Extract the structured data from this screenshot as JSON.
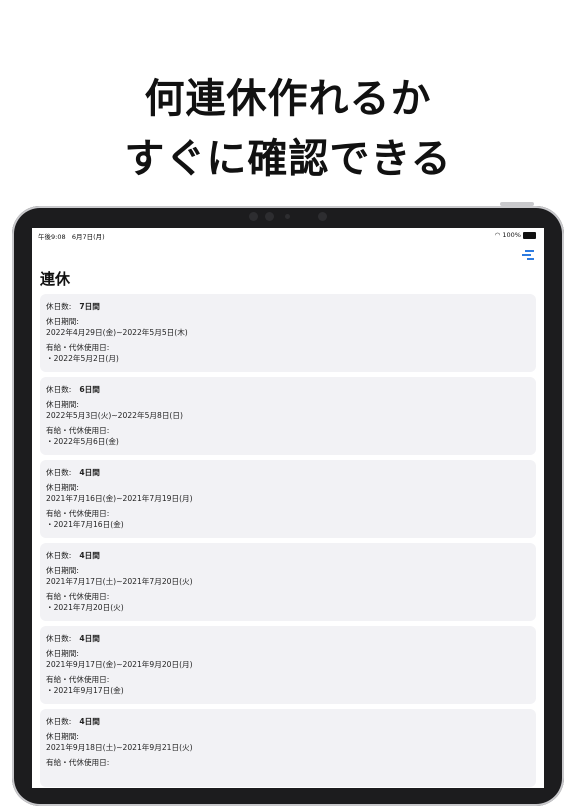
{
  "headline": {
    "line1": "何連休作れるか",
    "line2": "すぐに確認できる"
  },
  "status_bar": {
    "time": "午後9:08",
    "date": "6月7日(月)",
    "battery": "100%"
  },
  "nav": {
    "title": "連休"
  },
  "labels": {
    "days": "休日数:",
    "period": "休日期間:",
    "paid": "有給・代休使用日:"
  },
  "items": [
    {
      "days": "7日間",
      "period": "2022年4月29日(金)~2022年5月5日(木)",
      "paid_days": "・2022年5月2日(月)"
    },
    {
      "days": "6日間",
      "period": "2022年5月3日(火)~2022年5月8日(日)",
      "paid_days": "・2022年5月6日(金)"
    },
    {
      "days": "4日間",
      "period": "2021年7月16日(金)~2021年7月19日(月)",
      "paid_days": "・2021年7月16日(金)"
    },
    {
      "days": "4日間",
      "period": "2021年7月17日(土)~2021年7月20日(火)",
      "paid_days": "・2021年7月20日(火)"
    },
    {
      "days": "4日間",
      "period": "2021年9月17日(金)~2021年9月20日(月)",
      "paid_days": "・2021年9月17日(金)"
    },
    {
      "days": "4日間",
      "period": "2021年9月18日(土)~2021年9月21日(火)",
      "paid_days": ""
    }
  ],
  "icons": {
    "filter": "filter-icon",
    "wifi": "wifi-icon",
    "battery": "battery-icon"
  },
  "colors": {
    "accent": "#2d7be0",
    "card_bg": "#f2f2f5",
    "bezel": "#1c1c1e"
  }
}
